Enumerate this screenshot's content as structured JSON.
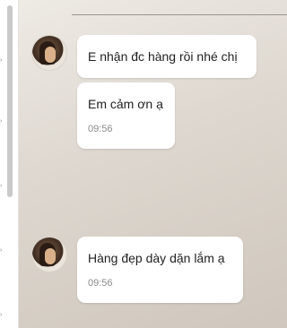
{
  "chat": {
    "messages": [
      {
        "text": "E nhận đc hàng rồi nhé chị",
        "time": ""
      },
      {
        "text": "Em cảm ơn ạ",
        "time": "09:56"
      },
      {
        "text": "Hàng đẹp dày dặn lắm ạ",
        "time": "09:56"
      }
    ]
  },
  "colors": {
    "bubble_bg": "#ffffff",
    "chat_bg": "#ddd7cf",
    "time_text": "#8a8a8a"
  },
  "icons": {
    "avatar": "sender-avatar"
  }
}
